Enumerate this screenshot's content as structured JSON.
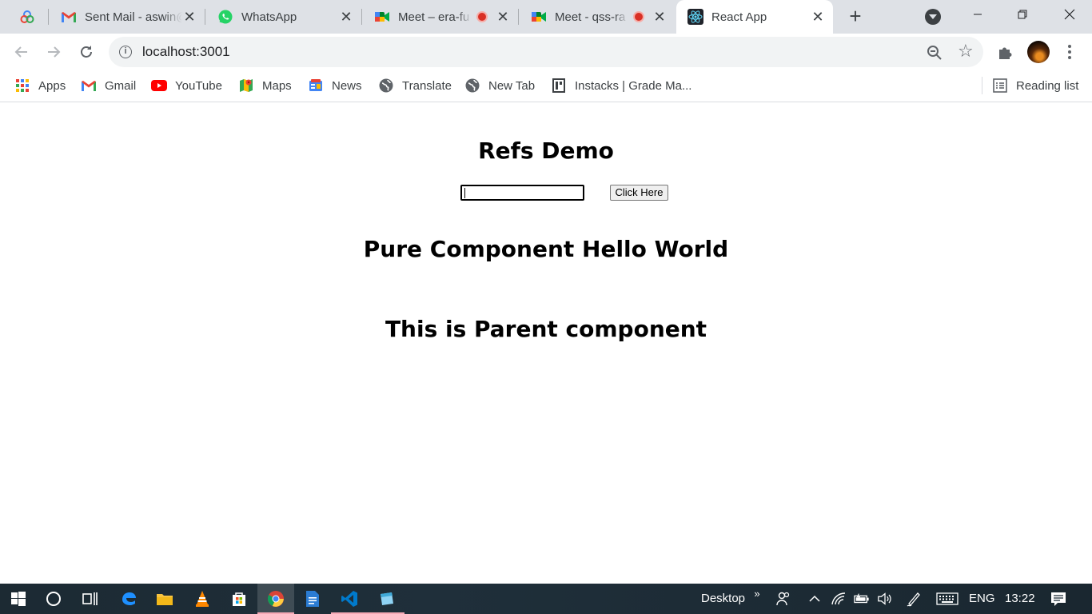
{
  "browser": {
    "tabs": [
      {
        "title": "Sent Mail - aswin@",
        "icon": "gmail-icon",
        "recording": false
      },
      {
        "title": "WhatsApp",
        "icon": "whatsapp-icon",
        "recording": false
      },
      {
        "title": "Meet – era-fu",
        "icon": "meet-icon",
        "recording": true
      },
      {
        "title": "Meet - qss-ra",
        "icon": "meet-icon",
        "recording": true
      },
      {
        "title": "React App",
        "icon": "react-icon",
        "recording": false,
        "active": true
      }
    ],
    "address": "localhost:3001",
    "bookmarks": [
      {
        "label": "Apps",
        "icon": "apps-grid-icon"
      },
      {
        "label": "Gmail",
        "icon": "gmail-icon"
      },
      {
        "label": "YouTube",
        "icon": "youtube-icon"
      },
      {
        "label": "Maps",
        "icon": "maps-icon"
      },
      {
        "label": "News",
        "icon": "news-icon"
      },
      {
        "label": "Translate",
        "icon": "globe-icon"
      },
      {
        "label": "New Tab",
        "icon": "globe-icon"
      },
      {
        "label": "Instacks | Grade Ma...",
        "icon": "instacks-icon"
      }
    ],
    "reading_list": "Reading list"
  },
  "page": {
    "refs_title": "Refs Demo",
    "input_value": "",
    "button_label": "Click Here",
    "pure_title": "Pure Component Hello World",
    "parent_title": "This is Parent component"
  },
  "taskbar": {
    "desktop_label": "Desktop",
    "language": "ENG",
    "time": "13:22"
  }
}
